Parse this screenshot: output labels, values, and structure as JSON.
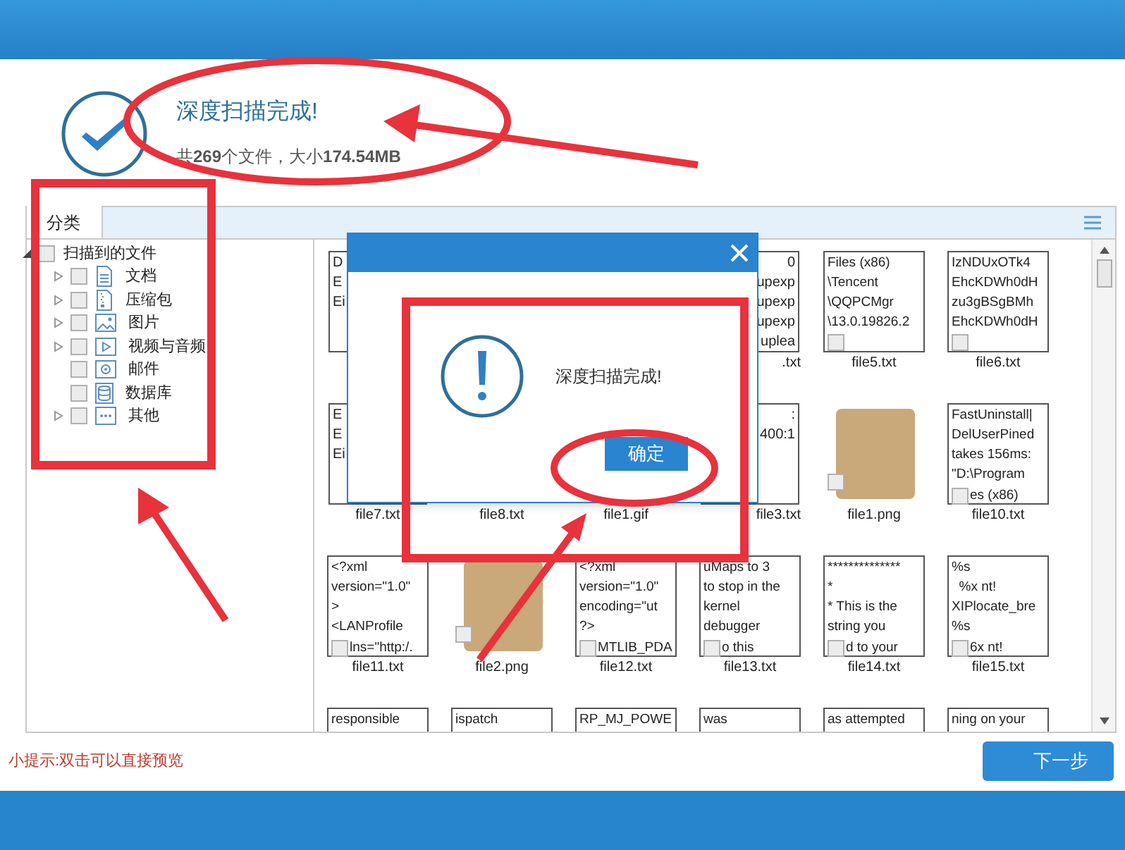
{
  "header": {
    "title": "深度扫描完成!",
    "summary": "共**269**个文件，大小**174.54MB**"
  },
  "tabs": [
    {
      "label": "分类",
      "selected": true
    }
  ],
  "tree": {
    "label": "扫描到的文件",
    "checked": false,
    "expanded": true,
    "children": [
      {
        "label": "文档",
        "kind": "group",
        "checked": false
      },
      {
        "label": "压缩包",
        "kind": "group",
        "checked": false
      },
      {
        "label": "图片",
        "kind": "group",
        "checked": false
      },
      {
        "label": "视频与音频",
        "kind": "group",
        "checked": false
      },
      {
        "label": "邮件",
        "kind": "leaf",
        "checked": false
      },
      {
        "label": "数据库",
        "kind": "leaf",
        "checked": false
      },
      {
        "label": "其他",
        "kind": "group",
        "checked": false
      }
    ]
  },
  "file_rows": [
    {
      "cards": [
        {
          "kind": "edge_left",
          "lines": [
            "D",
            "E",
            "Ei"
          ]
        },
        {
          "kind": "covered"
        },
        {
          "kind": "covered"
        },
        {
          "kind": "edge_right",
          "lines": [
            "0",
            "upexp",
            "upexp",
            "upexp",
            "uplea"
          ],
          "label": ".txt"
        },
        {
          "kind": "text",
          "lines": [
            "Files (x86)",
            "\\Tencent",
            "\\QQPCMgr",
            "\\13.0.19826.2"
          ],
          "label": "file5.txt",
          "checked": false
        },
        {
          "kind": "text",
          "lines": [
            "IzNDUxOTk4",
            "EhcKDWh0dH",
            "zu3gBSgBMh",
            "EhcKDWh0dH"
          ],
          "label": "file6.txt",
          "checked": false
        }
      ]
    },
    {
      "cards": [
        {
          "kind": "edge_left",
          "lines": [
            "E",
            "E",
            "Ei"
          ],
          "label": "file7.txt"
        },
        {
          "kind": "label_only",
          "label": "file8.txt"
        },
        {
          "kind": "label_only",
          "label": "file1.gif"
        },
        {
          "kind": "edge_right",
          "lines": [
            ":",
            "400:1"
          ],
          "label": "file3.txt"
        },
        {
          "kind": "image",
          "label": "file1.png",
          "checked": false
        },
        {
          "kind": "text",
          "lines": [
            "FastUninstall|",
            "DelUserPined",
            "takes 156ms:",
            "\"D:\\Program"
          ],
          "tail": "es (x86)",
          "label": "file10.txt",
          "checked": false
        }
      ]
    },
    {
      "cards": [
        {
          "kind": "text",
          "lines": [
            "<?xml",
            "version=\"1.0\"",
            ">",
            "<LANProfile"
          ],
          "tail": "lns=\"http:/.",
          "label": "file11.txt",
          "checked": false
        },
        {
          "kind": "image",
          "label": "file2.png",
          "checked": false
        },
        {
          "kind": "text",
          "lines": [
            "<?xml",
            "version=\"1.0\"",
            "encoding=\"ut",
            "?>"
          ],
          "tail": "MTLIB_PDA",
          "label": "file12.txt",
          "checked": false
        },
        {
          "kind": "text",
          "lines": [
            "uMaps to 3",
            "to stop in the",
            "kernel",
            "debugger"
          ],
          "tail": "o this",
          "label": "file13.txt",
          "checked": false
        },
        {
          "kind": "text",
          "lines": [
            "**************",
            "*",
            "* This is the",
            "string you"
          ],
          "tail": "d to your",
          "label": "file14.txt",
          "checked": false
        },
        {
          "kind": "text",
          "lines": [
            "%s",
            "  %x nt!",
            "XIPlocate_bre",
            "%s"
          ],
          "tail": "6x nt!",
          "label": "file15.txt",
          "checked": false
        }
      ]
    },
    {
      "cards": [
        {
          "kind": "text",
          "lines": [
            "responsible"
          ]
        },
        {
          "kind": "text",
          "lines": [
            "ispatch"
          ]
        },
        {
          "kind": "text",
          "lines": [
            "RP_MJ_POWE"
          ]
        },
        {
          "kind": "text",
          "lines": [
            "was"
          ]
        },
        {
          "kind": "text",
          "lines": [
            "as attempted"
          ]
        },
        {
          "kind": "text",
          "lines": [
            "ning on your"
          ]
        }
      ]
    }
  ],
  "hint": "小提示:双击可以直接预览",
  "next_button": "下一步",
  "dialog": {
    "message": "深度扫描完成!",
    "ok_button": "确定"
  }
}
